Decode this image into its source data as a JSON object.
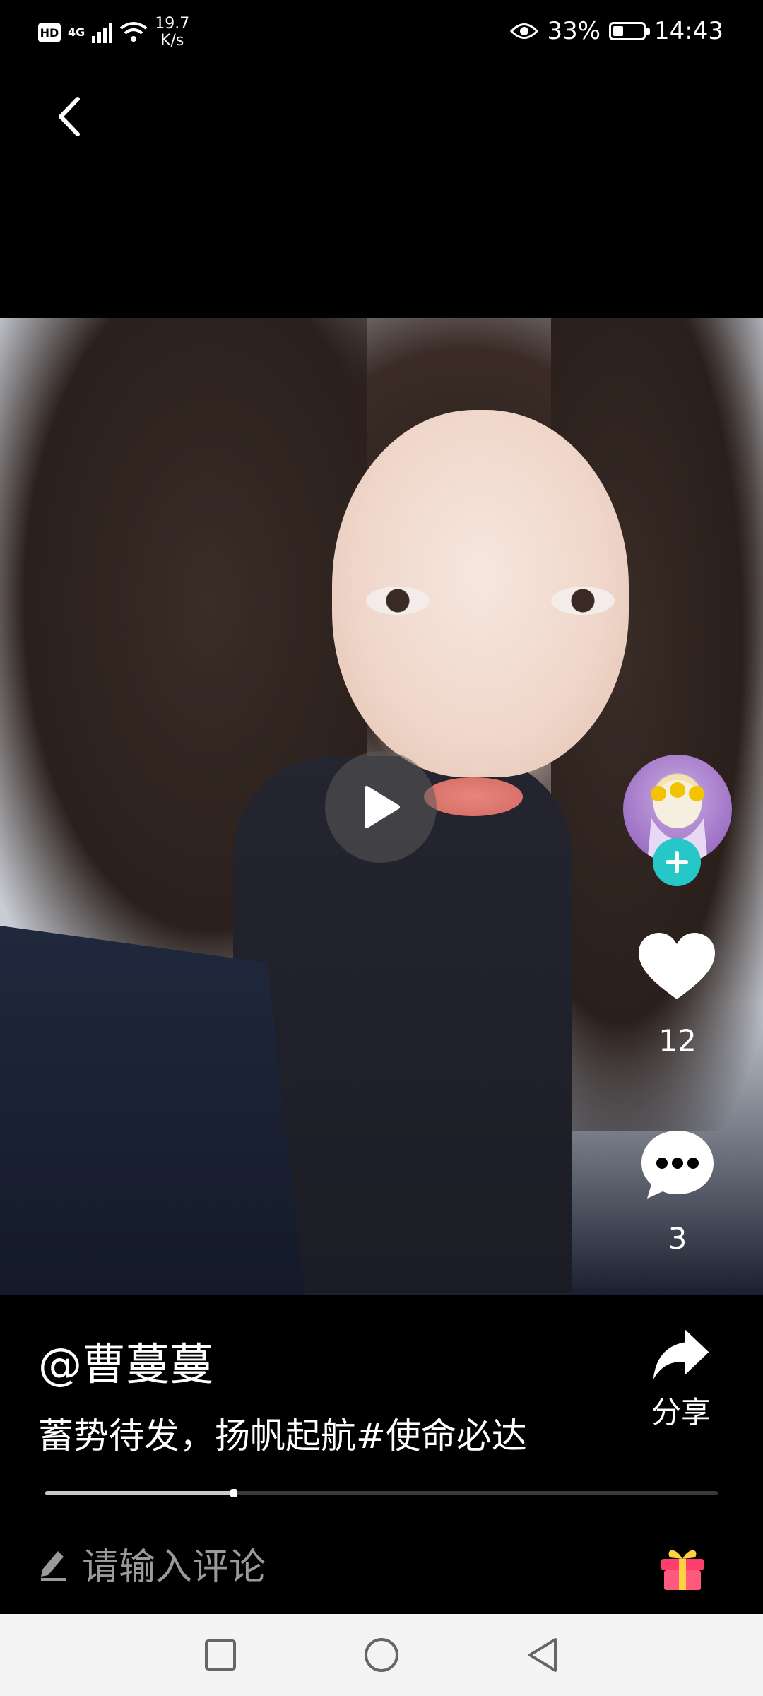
{
  "status_bar": {
    "hd": "HD",
    "network": "4G",
    "speed_value": "19.7",
    "speed_unit": "K/s",
    "battery": "33%",
    "time": "14:43"
  },
  "post": {
    "author": "@曹蔓蔓",
    "caption": "蓄势待发，扬帆起航#使命必达",
    "like_count": "12",
    "comment_count": "3",
    "share_label": "分享",
    "progress": 0.28
  },
  "comment_bar": {
    "placeholder": "请输入评论"
  },
  "colors": {
    "follow_accent": "#25c7c7",
    "gift": "#ff3d6e"
  }
}
